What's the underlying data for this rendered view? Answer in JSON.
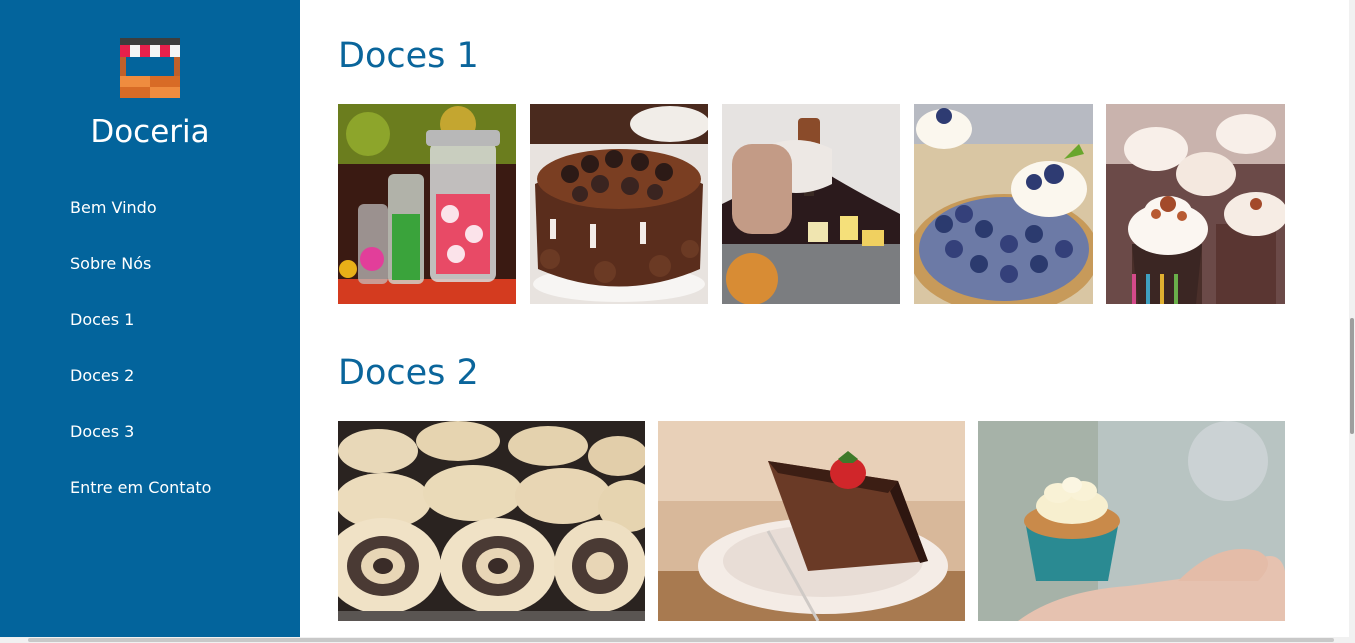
{
  "sidebar": {
    "brand": "Doceria",
    "nav": [
      {
        "label": "Bem Vindo"
      },
      {
        "label": "Sobre Nós"
      },
      {
        "label": "Doces 1"
      },
      {
        "label": "Doces 2"
      },
      {
        "label": "Doces 3"
      },
      {
        "label": "Entre em Contato"
      }
    ],
    "color": "#03649c"
  },
  "sections": [
    {
      "title": "Doces 1",
      "photos": [
        "candy-jars",
        "chocolate-cake",
        "chef-chocolate",
        "blueberry-tart",
        "cupcakes"
      ]
    },
    {
      "title": "Doces 2",
      "photos": [
        "poppy-seed-rolls",
        "chocolate-cake-slice",
        "cupcake-in-hand"
      ]
    }
  ],
  "accent": "#0a659b"
}
